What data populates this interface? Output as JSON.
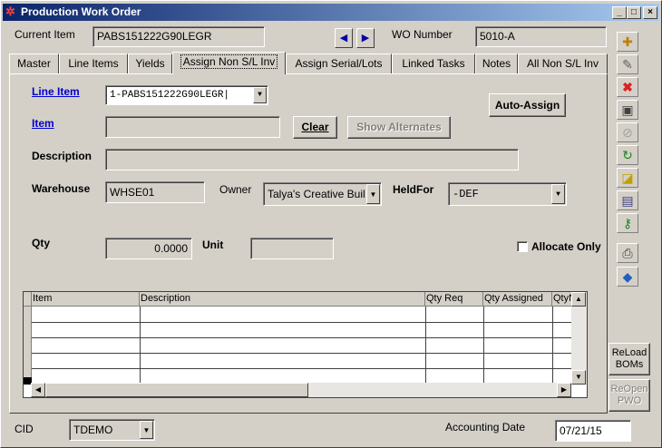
{
  "window": {
    "title": "Production Work Order",
    "min": "_",
    "max": "□",
    "close": "×"
  },
  "header": {
    "current_item_label": "Current Item",
    "current_item_value": "PABS151222G90LEGR",
    "wo_number_label": "WO Number",
    "wo_number_value": "5010-A",
    "prev_arrow": "◀",
    "next_arrow": "▶"
  },
  "tabs": [
    {
      "label": "Master"
    },
    {
      "label": "Line Items"
    },
    {
      "label": "Yields"
    },
    {
      "label": "Assign  Non S/L Inv"
    },
    {
      "label": "Assign Serial/Lots"
    },
    {
      "label": "Linked Tasks"
    },
    {
      "label": "Notes"
    },
    {
      "label": "All Non S/L Inv"
    }
  ],
  "form": {
    "line_item_label": "Line Item",
    "line_item_value": "1-PABS151222G90LEGR|",
    "item_label": "Item",
    "item_value": "",
    "clear_button": "Clear",
    "show_alternates_button": "Show Alternates",
    "auto_assign_button": "Auto-Assign",
    "description_label": "Description",
    "description_value": "",
    "warehouse_label": "Warehouse",
    "warehouse_value": "WHSE01",
    "owner_label": "Owner",
    "owner_value": "Talya's Creative Buil",
    "heldfor_label": "HeldFor",
    "heldfor_value": "-DEF",
    "qty_label": "Qty",
    "qty_value": "0.0000",
    "unit_label": "Unit",
    "unit_value": "",
    "allocate_only_label": "Allocate Only",
    "allocate_only_checked": false
  },
  "grid": {
    "columns": [
      "Item",
      "Description",
      "Qty Req",
      "Qty Assigned",
      "QtyN"
    ],
    "rows": []
  },
  "toolbar": {
    "icons": [
      "new-icon",
      "edit-icon",
      "delete-icon",
      "save-icon",
      "cancel-icon",
      "refresh-icon",
      "note-icon",
      "card-icon",
      "key-icon",
      "print-icon",
      "tag-icon"
    ],
    "reload_boms": "ReLoad BOMs",
    "reopen_pwo": "ReOpen PWO"
  },
  "footer": {
    "cid_label": "CID",
    "cid_value": "TDEMO",
    "accounting_date_label": "Accounting Date",
    "accounting_date_value": "07/21/15"
  }
}
